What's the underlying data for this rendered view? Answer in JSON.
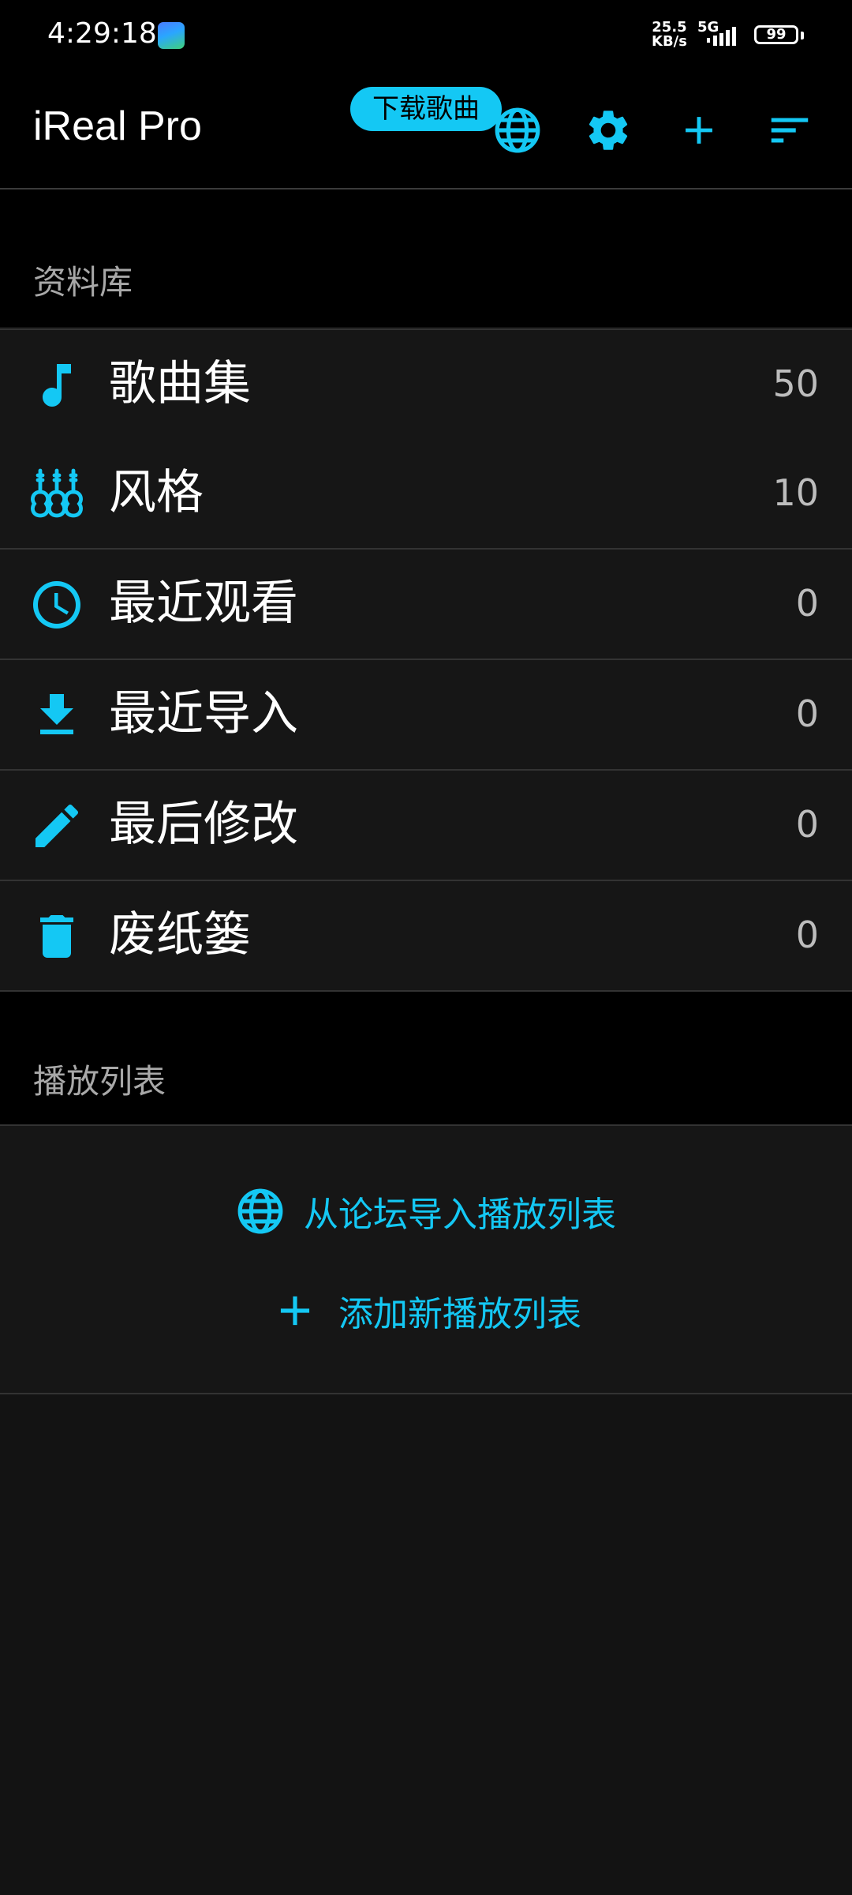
{
  "status_bar": {
    "time": "4:29:18",
    "net_speed_value": "25.5",
    "net_speed_unit": "KB/s",
    "network": "5G",
    "battery": "99"
  },
  "app_bar": {
    "title": "iReal Pro",
    "tooltip": "下载歌曲",
    "icons": [
      "globe-icon",
      "gear-icon",
      "plus-icon",
      "sort-icon"
    ]
  },
  "library": {
    "header": "资料库",
    "items": [
      {
        "label": "歌曲集",
        "count": "50",
        "icon": "music-note-icon"
      },
      {
        "label": "风格",
        "count": "10",
        "icon": "guitars-icon"
      },
      {
        "label": "最近观看",
        "count": "0",
        "icon": "clock-icon"
      },
      {
        "label": "最近导入",
        "count": "0",
        "icon": "download-icon"
      },
      {
        "label": "最后修改",
        "count": "0",
        "icon": "pencil-icon"
      },
      {
        "label": "废纸篓",
        "count": "0",
        "icon": "trash-icon"
      }
    ]
  },
  "playlists": {
    "header": "播放列表",
    "import_label": "从论坛导入播放列表",
    "add_label": "添加新播放列表"
  },
  "colors": {
    "accent": "#14c8f4",
    "background": "#131313",
    "header_bg": "#000000"
  }
}
